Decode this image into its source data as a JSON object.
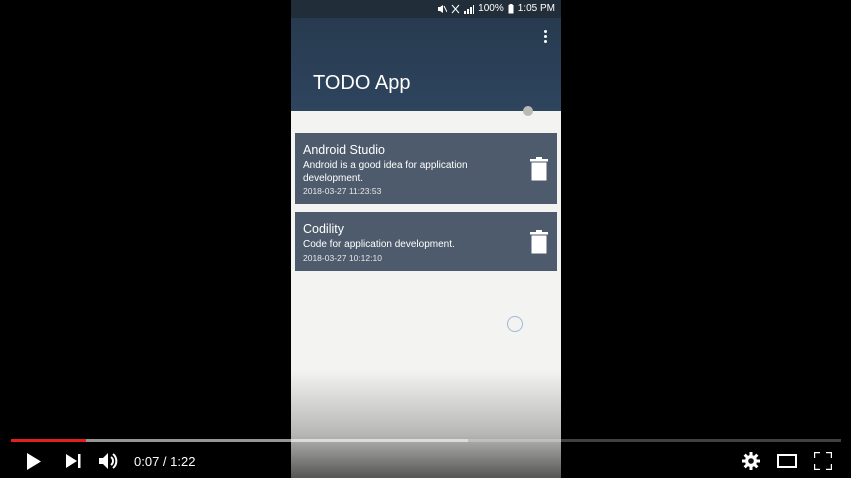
{
  "status_bar": {
    "battery": "100%",
    "time": "1:05 PM"
  },
  "app_bar": {
    "title": "TODO App",
    "menu_icon": "more-vert-icon"
  },
  "todos": [
    {
      "title": "Android Studio",
      "description": "Android is a good idea for application development.",
      "timestamp": "2018-03-27 11:23:53",
      "action_icon": "trash-icon"
    },
    {
      "title": "Codility",
      "description": "Code for application development.",
      "timestamp": "2018-03-27 10:12:10",
      "action_icon": "trash-icon"
    }
  ],
  "player": {
    "current_time": "0:07",
    "duration": "1:22",
    "time_display": "0:07 / 1:22",
    "played_fraction": 0.09,
    "buffered_fraction": 0.55,
    "progress_color": "#e0201f"
  },
  "colors": {
    "app_bar": "#273a4f",
    "card": "#4d5b6c",
    "background": "#f3f3f1"
  }
}
